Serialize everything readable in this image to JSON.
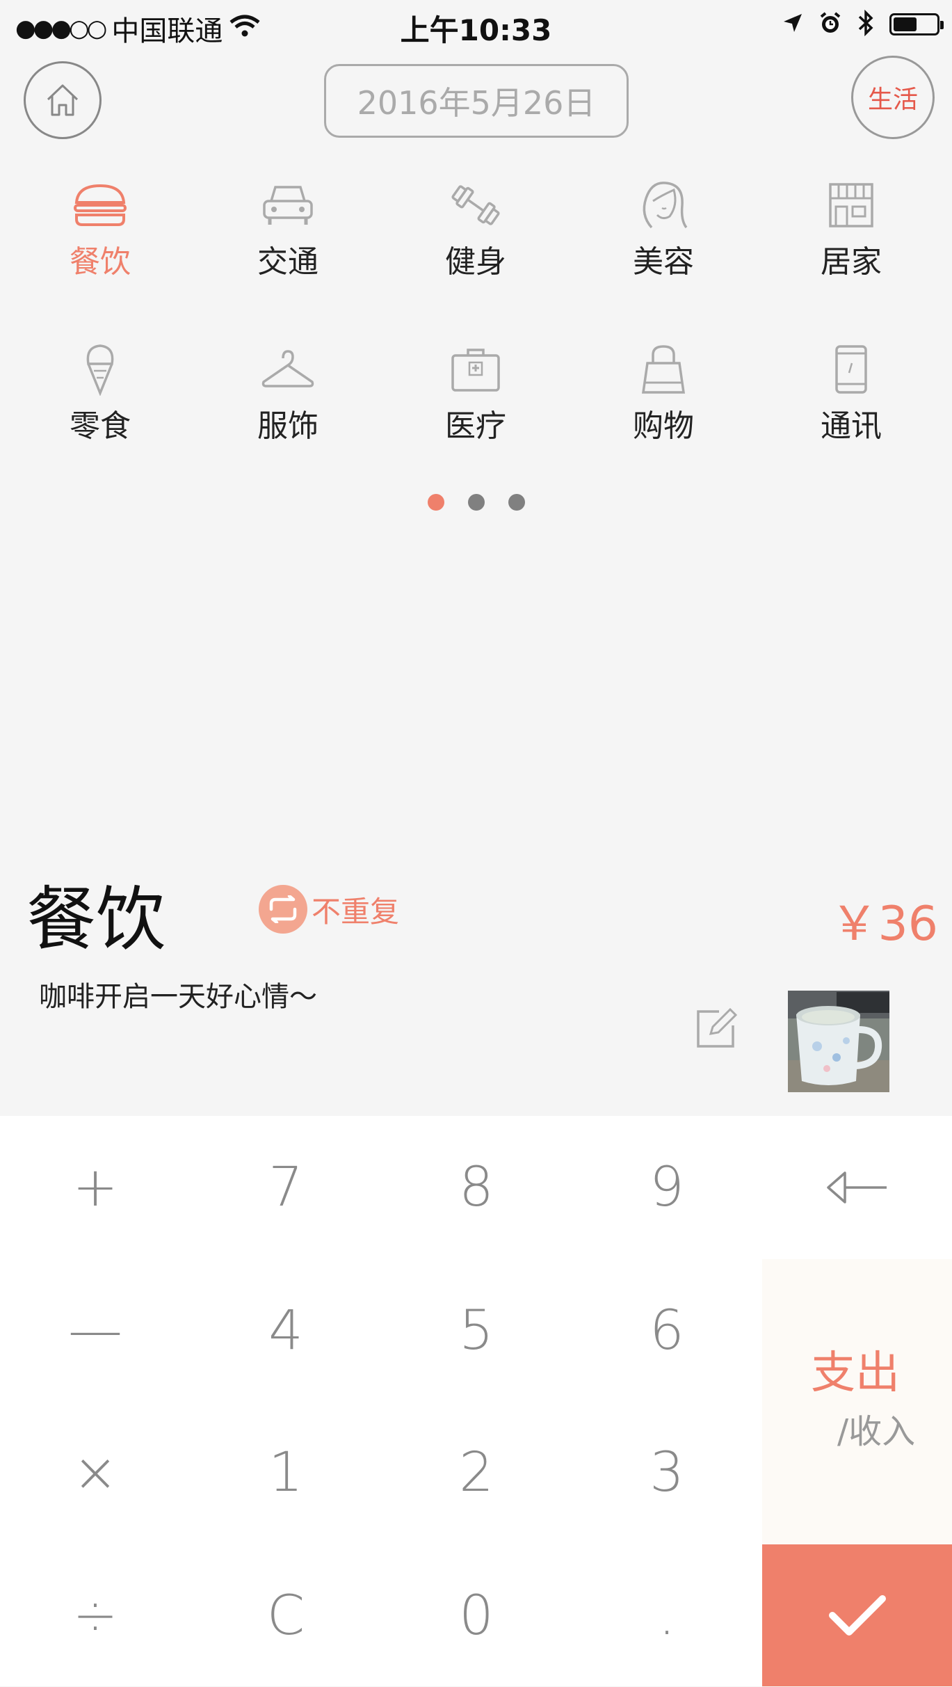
{
  "status_bar": {
    "carrier": "中国联通",
    "signal_dots": "●●●○○",
    "time": "上午10:33",
    "battery_level": 0.55
  },
  "header": {
    "date": "2016年5月26日",
    "mode": "生活"
  },
  "categories": [
    {
      "label": "餐饮",
      "icon": "burger-icon",
      "active": true
    },
    {
      "label": "交通",
      "icon": "car-icon"
    },
    {
      "label": "健身",
      "icon": "dumbbell-icon"
    },
    {
      "label": "美容",
      "icon": "face-icon"
    },
    {
      "label": "居家",
      "icon": "store-icon"
    },
    {
      "label": "零食",
      "icon": "icecream-icon"
    },
    {
      "label": "服饰",
      "icon": "hanger-icon"
    },
    {
      "label": "医疗",
      "icon": "medkit-icon"
    },
    {
      "label": "购物",
      "icon": "bag-icon"
    },
    {
      "label": "通讯",
      "icon": "phone-icon"
    }
  ],
  "pager": {
    "pages": 3,
    "current": 1
  },
  "entry": {
    "category": "餐饮",
    "repeat_label": "不重复",
    "amount": "￥36",
    "note": "咖啡开启一天好心情～"
  },
  "keypad": {
    "rows": [
      [
        "+",
        "7",
        "8",
        "9",
        "backspace"
      ],
      [
        "—",
        "4",
        "5",
        "6"
      ],
      [
        "×",
        "1",
        "2",
        "3"
      ],
      [
        "÷",
        "C",
        "0",
        "."
      ]
    ],
    "expense_label": "支出",
    "income_label": "/收入"
  },
  "colors": {
    "accent": "#ef806b",
    "background": "#f5f5f5",
    "keypad_bg": "#ffffff"
  }
}
